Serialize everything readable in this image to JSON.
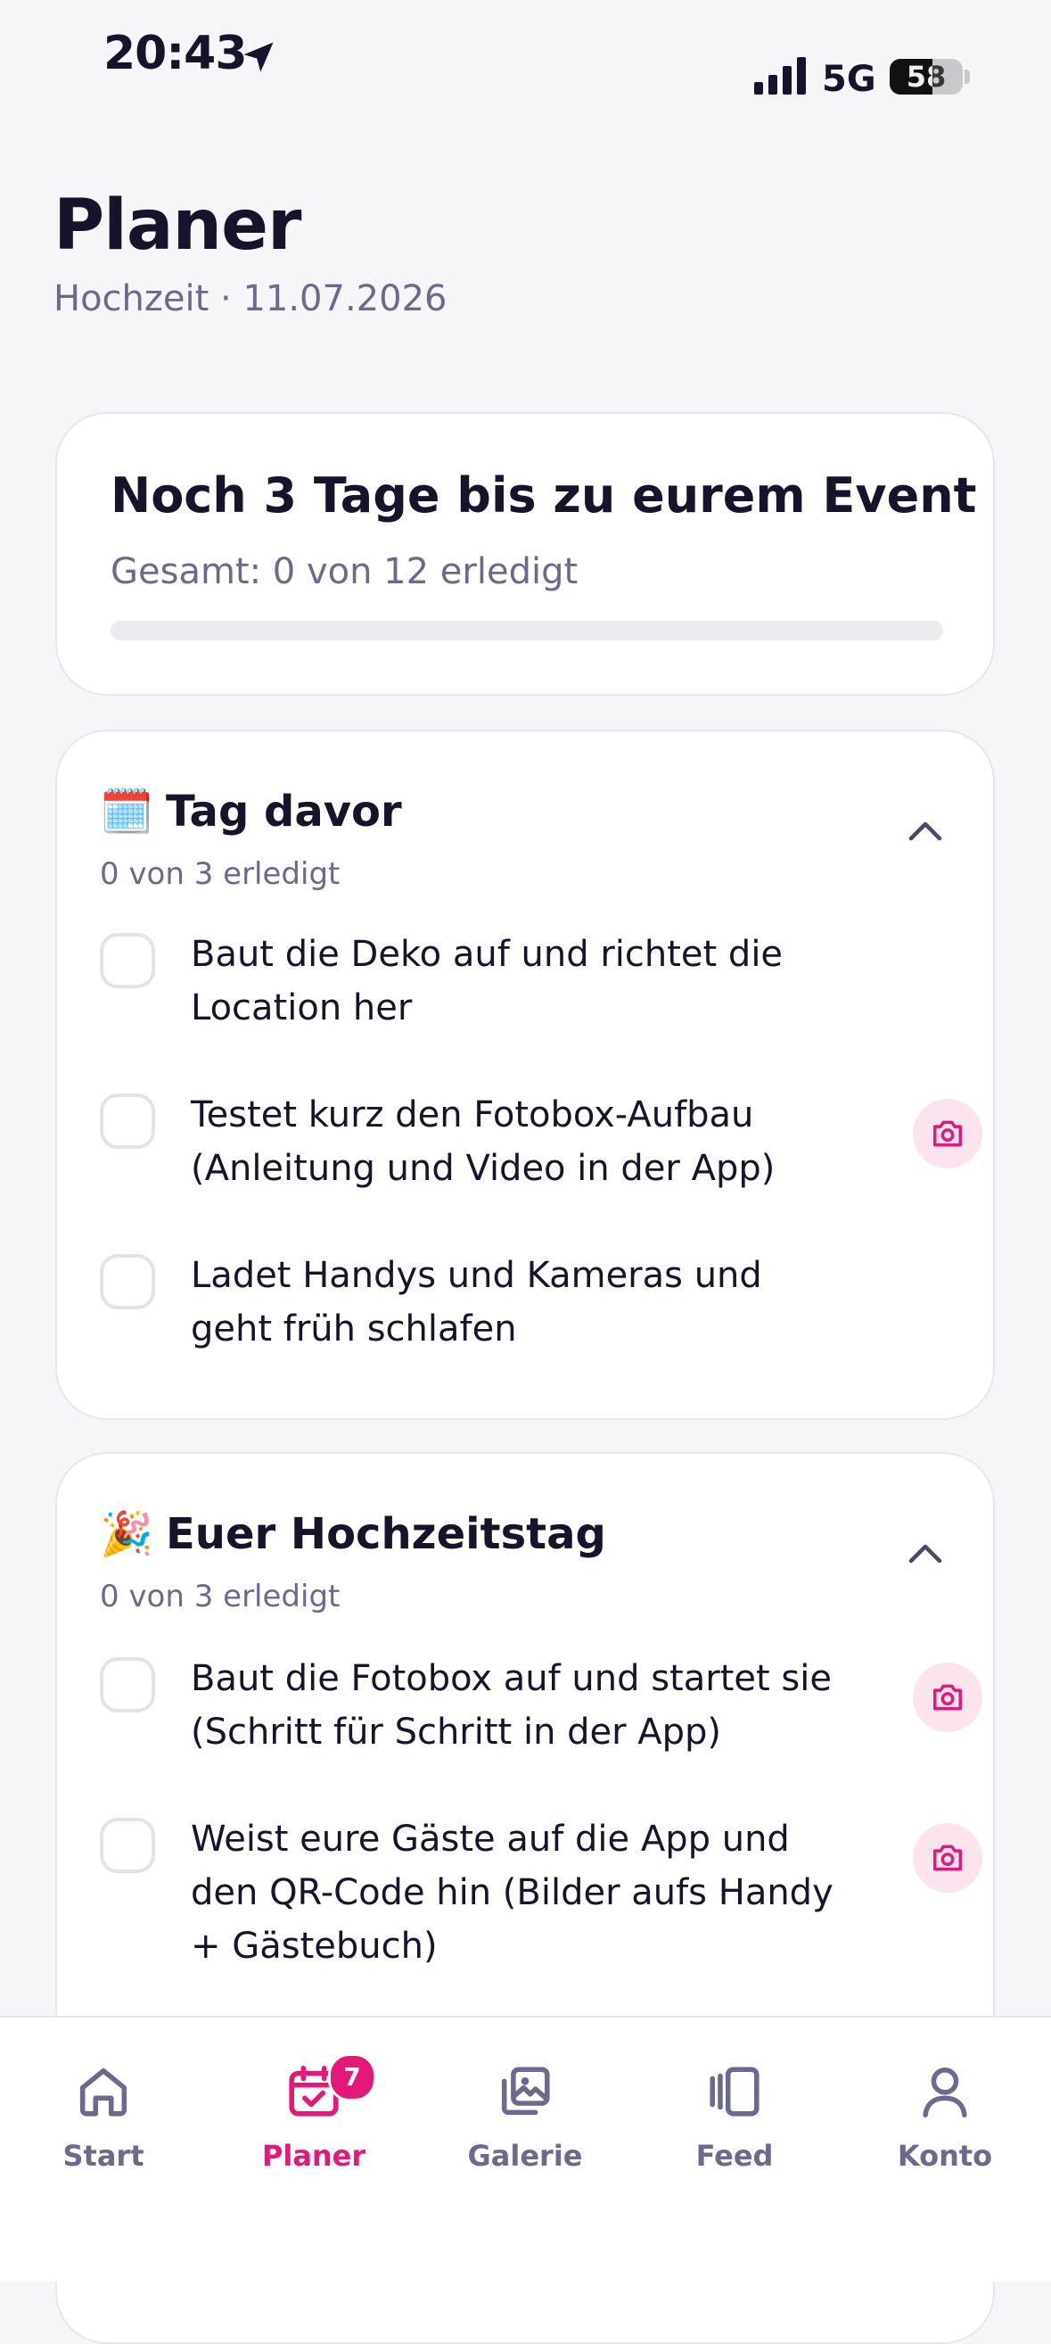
{
  "status": {
    "time": "20:43",
    "network": "5G",
    "battery": "58",
    "battery_level": 0.58
  },
  "header": {
    "title": "Planer",
    "subtitle": "Hochzeit · 11.07.2026"
  },
  "summary": {
    "title": "Noch 3 Tage bis zu eurem Event",
    "count": "Gesamt: 0 von 12 erledigt",
    "progress": 0
  },
  "sections": [
    {
      "emoji": "🗓️",
      "title": "Tag davor",
      "count": "0 von 3 erledigt",
      "tasks": [
        {
          "text": "Baut die Deko auf und richtet die Location her",
          "done": false,
          "camera": false
        },
        {
          "text": "Testet kurz den Fotobox-Aufbau (Anleitung und Video in der App)",
          "done": false,
          "camera": true
        },
        {
          "text": "Ladet Handys und Kameras und geht früh schlafen",
          "done": false,
          "camera": false
        }
      ]
    },
    {
      "emoji": "🎉",
      "title": "Euer Hochzeitstag",
      "count": "0 von 3 erledigt",
      "tasks": [
        {
          "text": "Baut die Fotobox auf und startet sie (Schritt für Schritt in der App)",
          "done": false,
          "camera": true
        },
        {
          "text": "Weist eure Gäste auf die App und den QR-Code hin (Bilder aufs Handy + Gästebuch)",
          "done": false,
          "camera": true
        }
      ]
    }
  ],
  "nav": [
    {
      "label": "Start",
      "icon": "home-icon",
      "active": false
    },
    {
      "label": "Planer",
      "icon": "calendar-check-icon",
      "active": true,
      "badge": "7"
    },
    {
      "label": "Galerie",
      "icon": "gallery-icon",
      "active": false
    },
    {
      "label": "Feed",
      "icon": "feed-icon",
      "active": false
    },
    {
      "label": "Konto",
      "icon": "user-icon",
      "active": false
    }
  ],
  "colors": {
    "accent": "#e6177a",
    "muted": "#6b6a8c",
    "text": "#15142a",
    "background": "#f6f6f8",
    "camera_bg": "#fce4ef"
  }
}
